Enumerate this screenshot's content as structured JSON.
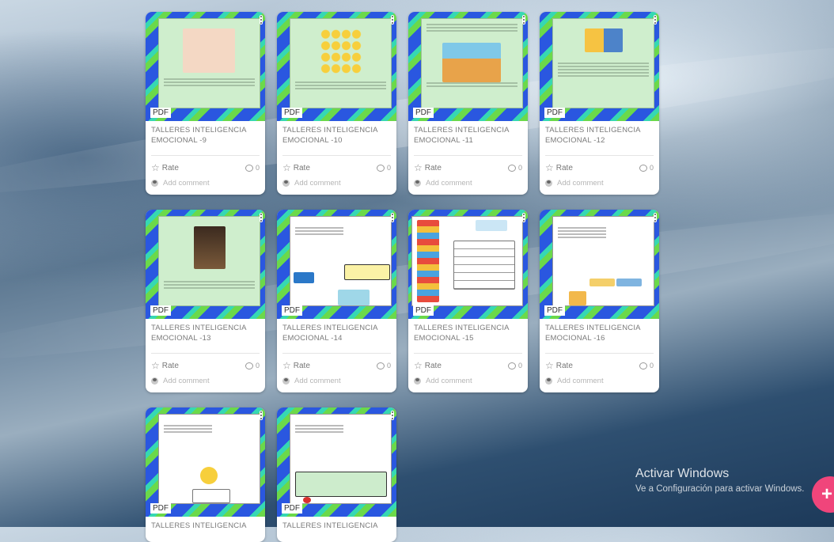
{
  "cards": [
    {
      "title": "TALLERES INTELIGENCIA EMOCIONAL -9",
      "pdf": "PDF",
      "rate": "Rate",
      "comments": "0",
      "add_comment": "Add comment"
    },
    {
      "title": "TALLERES INTELIGENCIA EMOCIONAL -10",
      "pdf": "PDF",
      "rate": "Rate",
      "comments": "0",
      "add_comment": "Add comment"
    },
    {
      "title": "TALLERES INTELIGENCIA EMOCIONAL -11",
      "pdf": "PDF",
      "rate": "Rate",
      "comments": "0",
      "add_comment": "Add comment"
    },
    {
      "title": "TALLERES INTELIGENCIA EMOCIONAL -12",
      "pdf": "PDF",
      "rate": "Rate",
      "comments": "0",
      "add_comment": "Add comment"
    },
    {
      "title": "TALLERES INTELIGENCIA EMOCIONAL -13",
      "pdf": "PDF",
      "rate": "Rate",
      "comments": "0",
      "add_comment": "Add comment"
    },
    {
      "title": "TALLERES INTELIGENCIA EMOCIONAL -14",
      "pdf": "PDF",
      "rate": "Rate",
      "comments": "0",
      "add_comment": "Add comment"
    },
    {
      "title": "TALLERES INTELIGENCIA EMOCIONAL -15",
      "pdf": "PDF",
      "rate": "Rate",
      "comments": "0",
      "add_comment": "Add comment"
    },
    {
      "title": "TALLERES INTELIGENCIA EMOCIONAL -16",
      "pdf": "PDF",
      "rate": "Rate",
      "comments": "0",
      "add_comment": "Add comment"
    },
    {
      "title": "TALLERES INTELIGENCIA",
      "pdf": "PDF"
    },
    {
      "title": "TALLERES INTELIGENCIA",
      "pdf": "PDF"
    }
  ],
  "watermark": {
    "line1": "Activar Windows",
    "line2": "Ve a Configuración para activar Windows."
  },
  "fab": {
    "label": "+"
  },
  "icons": {
    "star": "star-outline-icon",
    "comment": "comment-bubble-icon",
    "menu": "more-vertical-icon",
    "avatar": "user-avatar-icon",
    "add": "plus-icon"
  },
  "colors": {
    "accent": "#f0457b",
    "stripe_blue": "#2a57e0",
    "stripe_green": "#6bd94a",
    "stripe_cyan": "#36d8b3"
  }
}
